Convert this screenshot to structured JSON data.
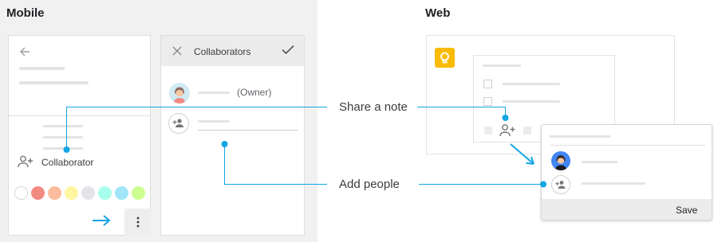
{
  "sections": {
    "mobile_title": "Mobile",
    "web_title": "Web"
  },
  "mobile": {
    "collaborator_label": "Collaborator",
    "collaborators_title": "Collaborators",
    "owner_label": "(Owner)",
    "palette": [
      "#ffffff",
      "#f28b82",
      "#fbbc9d",
      "#fff6a0",
      "#e8eaed",
      "#a7ffeb",
      "#a1e5f8",
      "#ccff90"
    ]
  },
  "callouts": {
    "share": "Share a note",
    "add": "Add people"
  },
  "web": {
    "save_label": "Save"
  },
  "colors": {
    "accent": "#12a5e4",
    "keep_yellow": "#f9bb04"
  }
}
